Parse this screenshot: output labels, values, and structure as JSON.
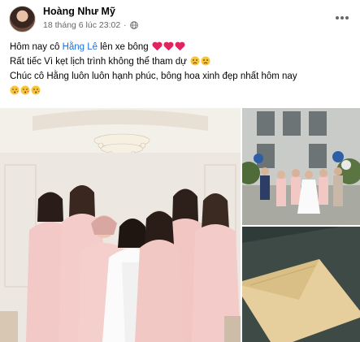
{
  "post": {
    "author": "Hoàng Như Mỹ",
    "timestamp": "18 tháng 6 lúc 23:02",
    "separator": "·",
    "privacy_icon": "globe-icon",
    "more_icon": "more-options-icon",
    "lines": {
      "l1_before": "Hôm nay cô ",
      "l1_mention": "Hằng Lê",
      "l1_after": " lên xe bông",
      "l2": "Rất tiếc Vì kẹt lịch trình không thể tham dự",
      "l3": "Chúc cô Hằng luôn luôn hạnh phúc, bông hoa xinh đẹp nhất hôm nay"
    },
    "emojis": {
      "hearts": [
        "red-heart-icon",
        "red-heart-icon",
        "red-heart-icon"
      ],
      "sad": [
        "sad-face-icon",
        "sad-face-icon"
      ],
      "kiss": [
        "kiss-face-icon",
        "kiss-face-icon",
        "kiss-face-icon"
      ]
    },
    "photos": [
      "bridesmaids-group-photo",
      "wedding-party-outdoor-photo",
      "gift-envelope-photo"
    ]
  },
  "colors": {
    "text": "#050505",
    "secondary": "#65676b",
    "mention": "#216fdb",
    "heart": "#e0245e",
    "dress": "#f2c9c6"
  }
}
